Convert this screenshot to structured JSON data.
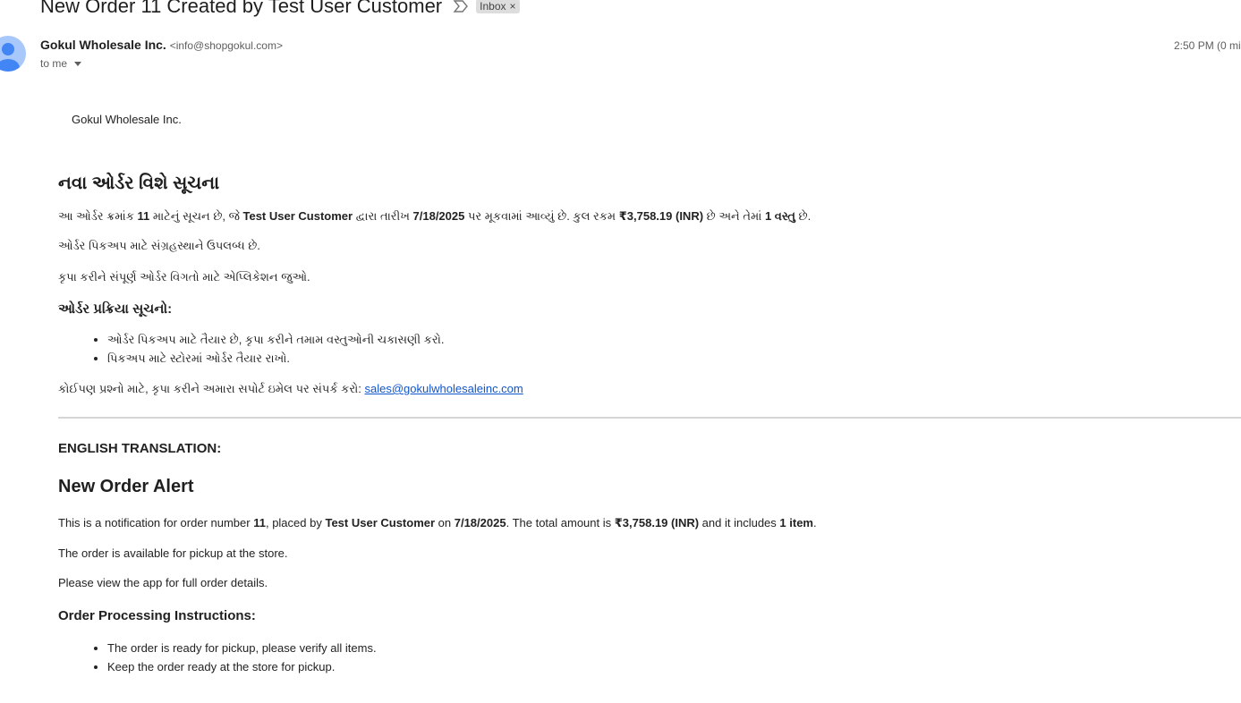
{
  "email": {
    "subject": "New Order 11 Created by Test User Customer",
    "label_badge": "Inbox",
    "badge_close": "×",
    "sender_name": "Gokul Wholesale Inc.",
    "sender_email": "<info@shopgokul.com>",
    "recipient": "to me",
    "timestamp": "2:50 PM (0 mi"
  },
  "body": {
    "brand_text": "Gokul Wholesale Inc.",
    "gujarati": {
      "heading": "નવા ઓર્ડર વિશે સૂચના",
      "p1": {
        "t1": "આ ઓર્ડર ક્રમાંક ",
        "order_no": "11",
        "t2": " માટેનું સૂચન છે, જે ",
        "customer": "Test User Customer",
        "t3": " દ્વારા તારીખ ",
        "date": "7/18/2025",
        "t4": " પર મૂકવામાં આવ્યું છે. કુલ રકમ ",
        "amount": "₹3,758.19 (INR)",
        "t5": " છે અને તેમાં ",
        "items": "1 વસ્તુ",
        "t6": " છે."
      },
      "p2": "ઓર્ડર પિકઅપ માટે સંગ્રહસ્થાને ઉપલબ્ધ છે.",
      "p3": "કૃપા કરીને સંપૂર્ણ ઓર્ડર વિગતો માટે એપ્લિકેશન જુઓ.",
      "instructions_heading": "ઓર્ડર પ્રક્રિયા સૂચનો:",
      "instructions": [
        "ઓર્ડર પિકઅપ માટે તૈયાર છે, કૃપા કરીને તમામ વસ્તુઓની ચકાસણી કરો.",
        "પિકઅપ માટે સ્ટોરમાં ઓર્ડર તૈયાર રાખો."
      ],
      "contact_text": "કોઈપણ પ્રશ્નો માટે, કૃપા કરીને અમારા સપોર્ટ ઇમેલ પર સંપર્ક કરો: ",
      "contact_email": "sales@gokulwholesaleinc.com"
    },
    "english": {
      "translation_label": "ENGLISH TRANSLATION:",
      "heading": "New Order Alert",
      "p1": {
        "t1": "This is a notification for order number ",
        "order_no": "11",
        "t2": ", placed by ",
        "customer": "Test User Customer",
        "t3": " on ",
        "date": "7/18/2025",
        "t4": ". The total amount is ",
        "amount": "₹3,758.19 (INR)",
        "t5": " and it includes ",
        "items": "1 item",
        "t6": "."
      },
      "p2": "The order is available for pickup at the store.",
      "p3": "Please view the app for full order details.",
      "instructions_heading": "Order Processing Instructions:",
      "instructions": [
        "The order is ready for pickup, please verify all items.",
        "Keep the order ready at the store for pickup."
      ]
    }
  },
  "colors": {
    "link": "#1155cc",
    "avatar_bg": "#a8c7fa",
    "avatar_fg": "#4285f4"
  }
}
